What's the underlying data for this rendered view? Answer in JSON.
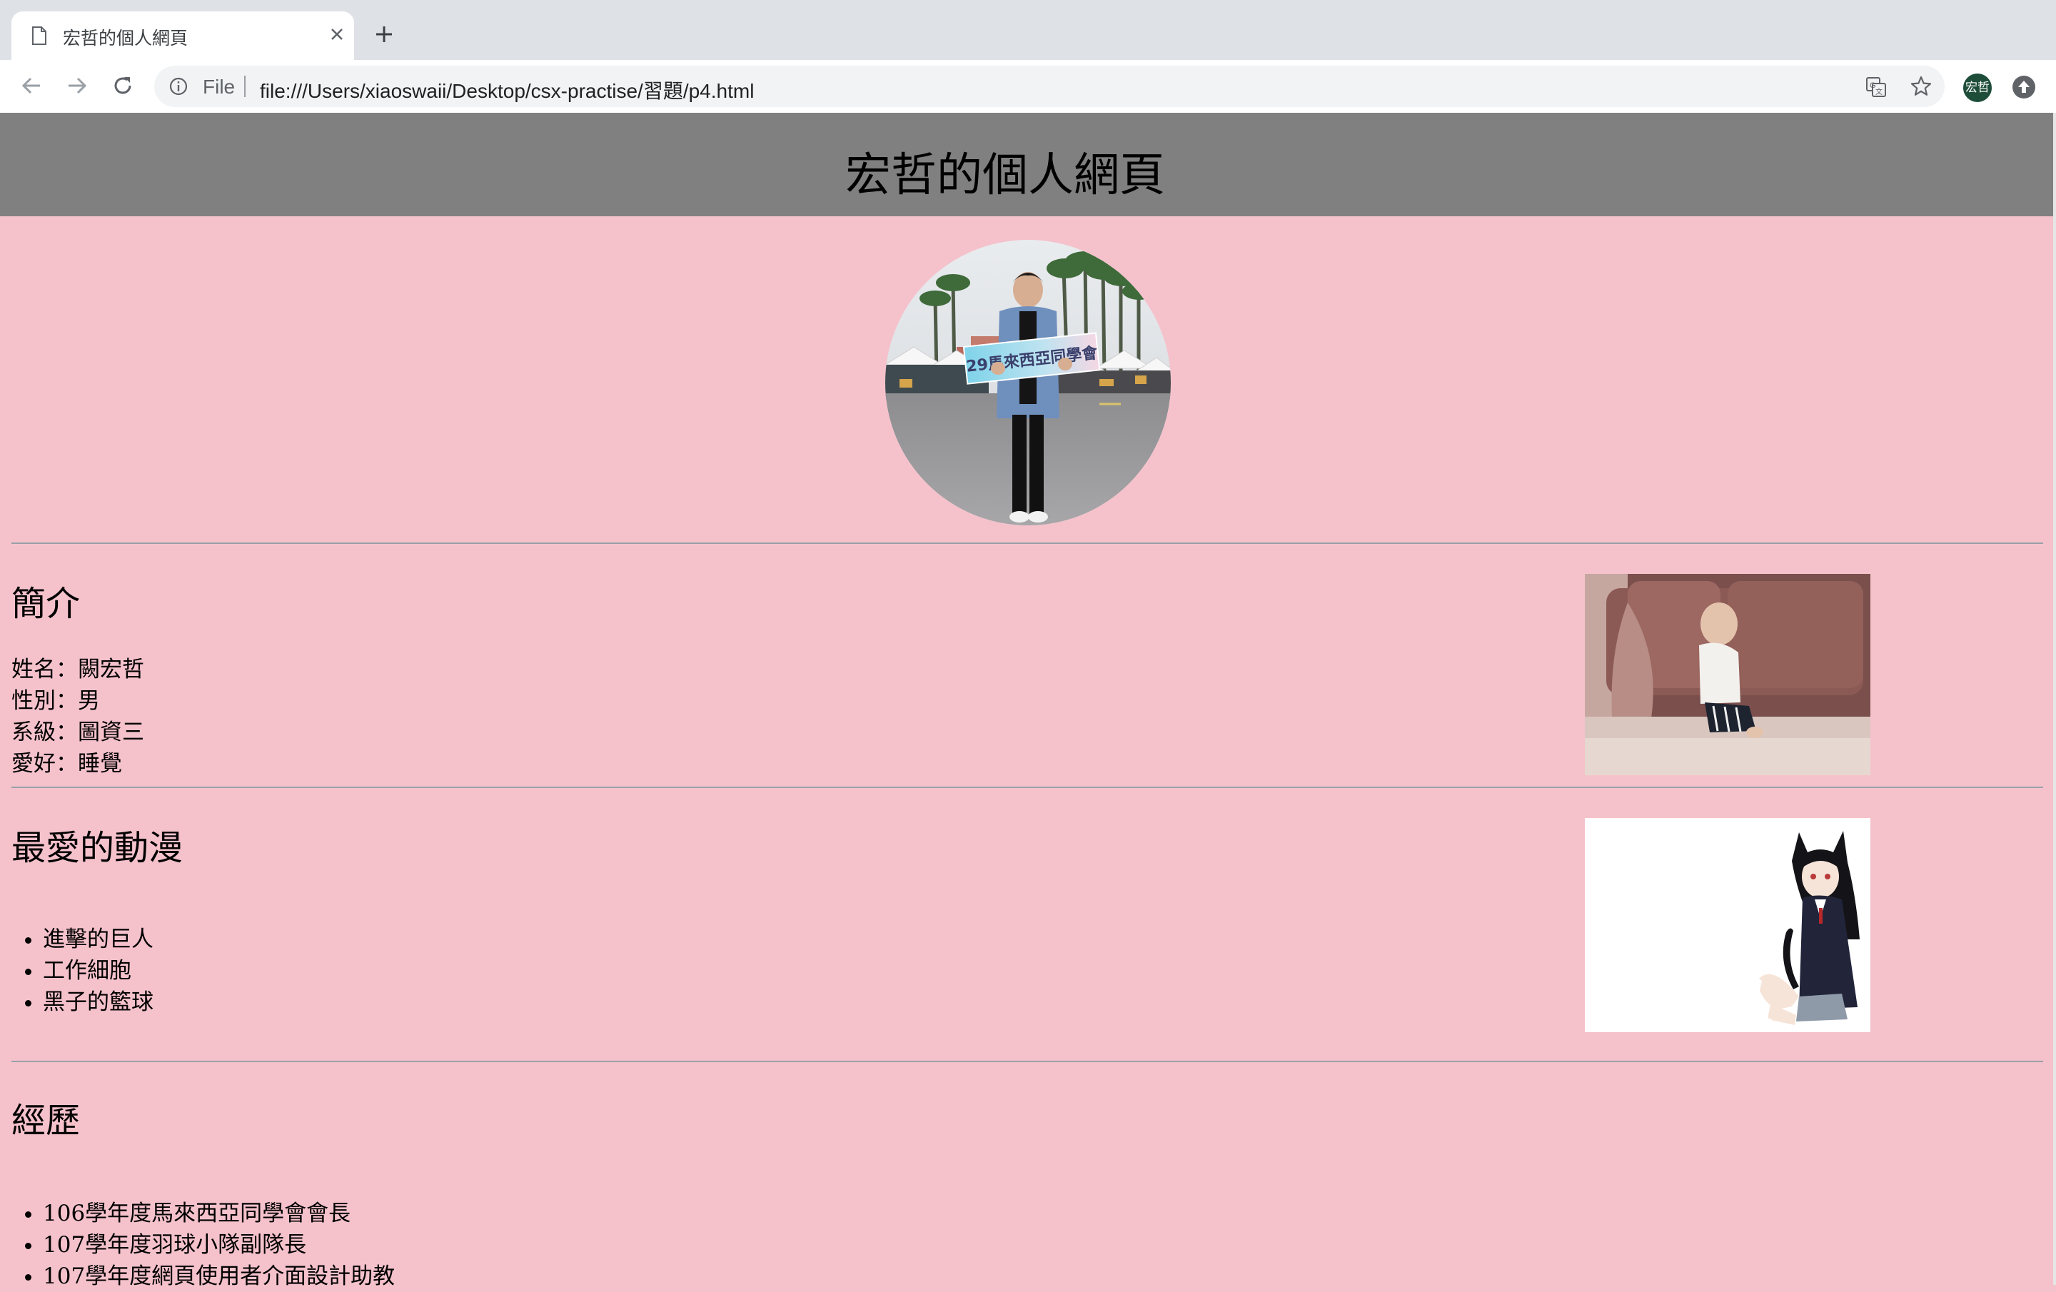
{
  "browser": {
    "tab_title": "宏哲的個人網頁",
    "omnibox_scheme": "File",
    "url": "file:///Users/xiaoswaii/Desktop/csx-practise/習題/p4.html",
    "profile_initials": "宏哲"
  },
  "page": {
    "title": "宏哲的個人網頁",
    "profile_sign_text": "29馬來西亞同學會",
    "intro": {
      "heading": "簡介",
      "lines": [
        "姓名：闕宏哲",
        "性別：男",
        "系級：圖資三",
        "愛好：睡覺"
      ]
    },
    "anime": {
      "heading": "最愛的動漫",
      "items": [
        "進擊的巨人",
        "工作細胞",
        "黑子的籃球"
      ]
    },
    "experience": {
      "heading": "經歷",
      "items": [
        "106學年度馬來西亞同學會會長",
        "107學年度羽球小隊副隊長",
        "107學年度網頁使用者介面設計助教"
      ]
    }
  },
  "colors": {
    "page_background": "#f5c2cc",
    "header_background": "#808080",
    "tab_strip": "#dee1e6"
  }
}
